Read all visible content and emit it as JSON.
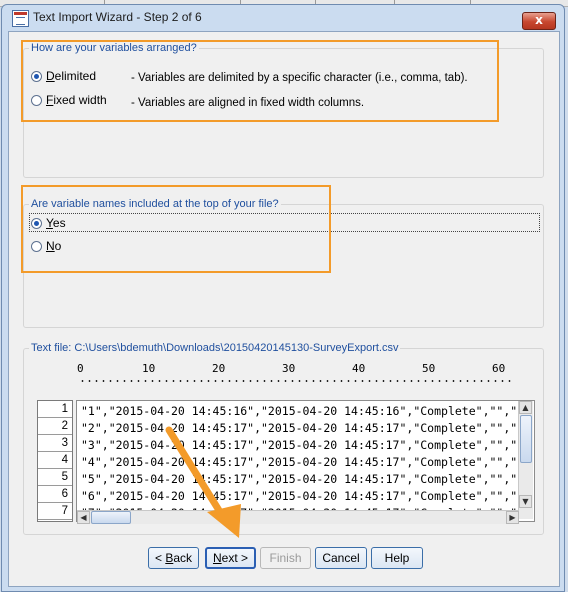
{
  "window": {
    "title": "Text Import Wizard - Step 2 of 6",
    "close_glyph": "x",
    "app_icon": "spreadsheet-icon"
  },
  "arrangement": {
    "legend": "How are your variables arranged?",
    "options": [
      {
        "label": "Delimited",
        "underline": "D",
        "rest": "elimited",
        "description": "- Variables are delimited by a specific character (i.e., comma, tab).",
        "selected": true
      },
      {
        "label": "Fixed width",
        "underline": "F",
        "rest": "ixed width",
        "description": "- Variables are aligned in fixed width columns.",
        "selected": false
      }
    ]
  },
  "names": {
    "legend": "Are variable names included at the top of your file?",
    "options": [
      {
        "label": "Yes",
        "underline": "Y",
        "rest": "es",
        "selected": true
      },
      {
        "label": "No",
        "underline": "N",
        "rest": "o",
        "selected": false
      }
    ]
  },
  "textfile": {
    "legend": "Text file:  C:\\Users\\bdemuth\\Downloads\\20150420145130-SurveyExport.csv",
    "ruler_numbers": [
      "0",
      "10",
      "20",
      "30",
      "40",
      "50",
      "60"
    ],
    "rows": [
      {
        "num": "1",
        "text": "\"1\",\"2015-04-20 14:45:16\",\"2015-04-20 14:45:16\",\"Complete\",\"\",\""
      },
      {
        "num": "2",
        "text": "\"2\",\"2015-04-20 14:45:17\",\"2015-04-20 14:45:17\",\"Complete\",\"\",\""
      },
      {
        "num": "3",
        "text": "\"3\",\"2015-04-20 14:45:17\",\"2015-04-20 14:45:17\",\"Complete\",\"\",\""
      },
      {
        "num": "4",
        "text": "\"4\",\"2015-04-20 14:45:17\",\"2015-04-20 14:45:17\",\"Complete\",\"\",\""
      },
      {
        "num": "5",
        "text": "\"5\",\"2015-04-20 14:45:17\",\"2015-04-20 14:45:17\",\"Complete\",\"\",\""
      },
      {
        "num": "6",
        "text": "\"6\",\"2015-04-20 14:45:17\",\"2015-04-20 14:45:17\",\"Complete\",\"\",\""
      },
      {
        "num": "7",
        "text": "\"7\",\"2015-04-20 14:45:17\",\"2015-04-20 14:45:17\",\"Complete\",\"\",\""
      }
    ]
  },
  "buttons": {
    "back": {
      "label": "< Back",
      "pre": "< ",
      "underline": "B",
      "rest": "ack"
    },
    "next": {
      "label": "Next >",
      "underline": "N",
      "rest": "ext >"
    },
    "finish": {
      "label": "Finish"
    },
    "cancel": {
      "label": "Cancel"
    },
    "help": {
      "label": "Help"
    }
  },
  "colors": {
    "highlight": "#f39b2a",
    "legend_text": "#1f4f9e",
    "annotation_arrow": "#f39b2a"
  }
}
